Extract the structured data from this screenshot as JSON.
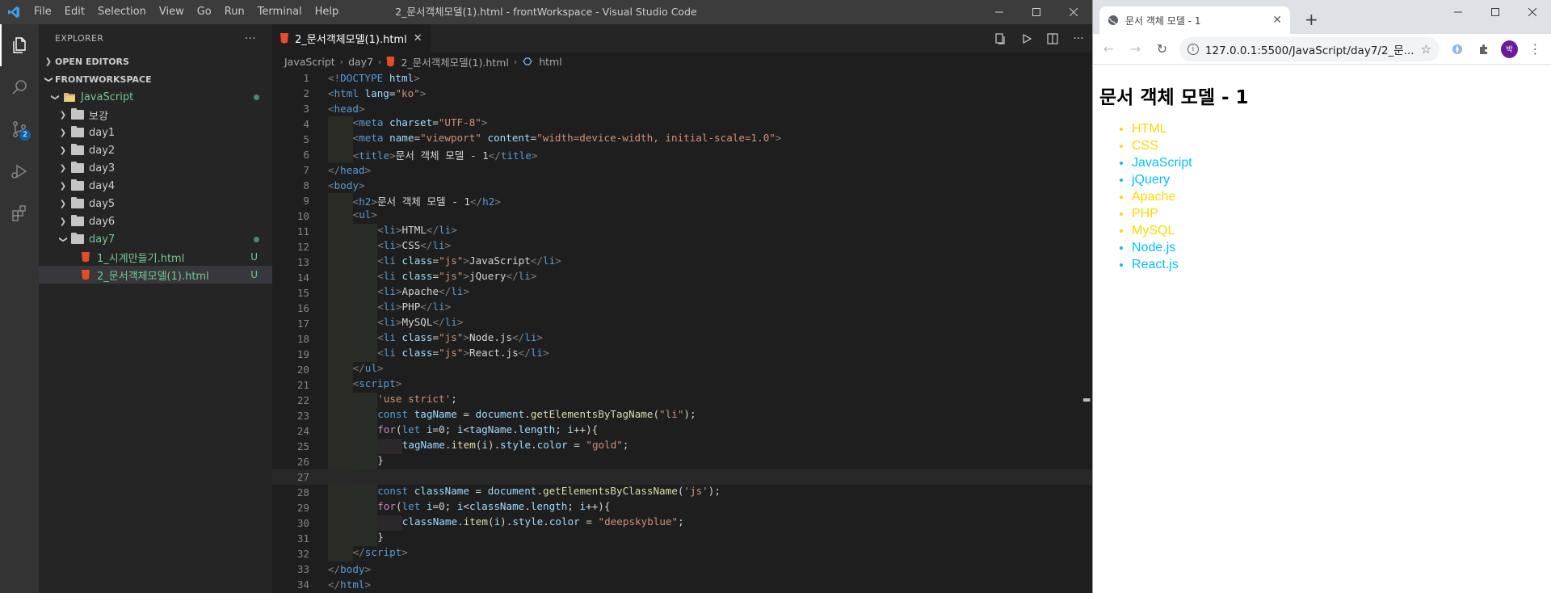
{
  "vscode": {
    "window_title": "2_문서객체모델(1).html - frontWorkspace - Visual Studio Code",
    "menu": [
      "File",
      "Edit",
      "Selection",
      "View",
      "Go",
      "Run",
      "Terminal",
      "Help"
    ],
    "activity_badge": "2",
    "explorer": {
      "title": "EXPLORER",
      "more": "···",
      "open_editors": "OPEN EDITORS",
      "workspace": "FRONTWORKSPACE",
      "tree": [
        {
          "label": "JavaScript",
          "type": "folder-open",
          "depth": 0,
          "color": "#73c991"
        },
        {
          "label": "보강",
          "type": "folder",
          "depth": 1
        },
        {
          "label": "day1",
          "type": "folder",
          "depth": 1
        },
        {
          "label": "day2",
          "type": "folder",
          "depth": 1
        },
        {
          "label": "day3",
          "type": "folder",
          "depth": 1
        },
        {
          "label": "day4",
          "type": "folder",
          "depth": 1
        },
        {
          "label": "day5",
          "type": "folder",
          "depth": 1
        },
        {
          "label": "day6",
          "type": "folder",
          "depth": 1
        },
        {
          "label": "day7",
          "type": "folder-open",
          "depth": 1,
          "color": "#73c991"
        },
        {
          "label": "1_시계만들기.html",
          "type": "html",
          "depth": 2,
          "status": "U",
          "color": "#73c991"
        },
        {
          "label": "2_문서객체모델(1).html",
          "type": "html",
          "depth": 2,
          "status": "U",
          "color": "#73c991",
          "selected": true
        }
      ]
    },
    "tab": {
      "label": "2_문서객체모델(1).html",
      "close": "✕"
    },
    "breadcrumb": [
      "JavaScript",
      "day7",
      "2_문서객체모델(1).html",
      "html"
    ],
    "code_lines": [
      {
        "n": "1",
        "indent": 0,
        "html": "<span class='t-br'>&lt;!</span><span class='t-tag'>DOCTYPE</span> <span class='t-attr'>html</span><span class='t-br'>&gt;</span>"
      },
      {
        "n": "2",
        "indent": 0,
        "html": "<span class='t-br'>&lt;</span><span class='t-tag'>html</span> <span class='t-attr'>lang</span><span class='t-text'>=</span><span class='t-str'>\"ko\"</span><span class='t-br'>&gt;</span>"
      },
      {
        "n": "3",
        "indent": 0,
        "html": "<span class='t-br'>&lt;</span><span class='t-tag'>head</span><span class='t-br'>&gt;</span>"
      },
      {
        "n": "4",
        "indent": 1,
        "html": "<span class='t-br'>&lt;</span><span class='t-tag'>meta</span> <span class='t-attr'>charset</span><span class='t-text'>=</span><span class='t-str'>\"UTF-8\"</span><span class='t-br'>&gt;</span>"
      },
      {
        "n": "5",
        "indent": 1,
        "html": "<span class='t-br'>&lt;</span><span class='t-tag'>meta</span> <span class='t-attr'>name</span><span class='t-text'>=</span><span class='t-str'>\"viewport\"</span> <span class='t-attr'>content</span><span class='t-text'>=</span><span class='t-str'>\"width=device-width, initial-scale=1.0\"</span><span class='t-br'>&gt;</span>"
      },
      {
        "n": "6",
        "indent": 1,
        "html": "<span class='t-br'>&lt;</span><span class='t-tag'>title</span><span class='t-br'>&gt;</span><span class='t-text'>문서 객체 모델 - 1</span><span class='t-br'>&lt;/</span><span class='t-tag'>title</span><span class='t-br'>&gt;</span>"
      },
      {
        "n": "7",
        "indent": 0,
        "html": "<span class='t-br'>&lt;/</span><span class='t-tag'>head</span><span class='t-br'>&gt;</span>"
      },
      {
        "n": "8",
        "indent": 0,
        "html": "<span class='t-br'>&lt;</span><span class='t-tag'>body</span><span class='t-br'>&gt;</span>"
      },
      {
        "n": "9",
        "indent": 1,
        "html": "<span class='t-br'>&lt;</span><span class='t-tag'>h2</span><span class='t-br'>&gt;</span><span class='t-text'>문서 객체 모델 - 1</span><span class='t-br'>&lt;/</span><span class='t-tag'>h2</span><span class='t-br'>&gt;</span>"
      },
      {
        "n": "10",
        "indent": 1,
        "html": "<span class='t-br'>&lt;</span><span class='t-tag'>ul</span><span class='t-br'>&gt;</span>"
      },
      {
        "n": "11",
        "indent": 2,
        "html": "<span class='t-br'>&lt;</span><span class='t-tag'>li</span><span class='t-br'>&gt;</span><span class='t-text'>HTML</span><span class='t-br'>&lt;/</span><span class='t-tag'>li</span><span class='t-br'>&gt;</span>"
      },
      {
        "n": "12",
        "indent": 2,
        "html": "<span class='t-br'>&lt;</span><span class='t-tag'>li</span><span class='t-br'>&gt;</span><span class='t-text'>CSS</span><span class='t-br'>&lt;/</span><span class='t-tag'>li</span><span class='t-br'>&gt;</span>"
      },
      {
        "n": "13",
        "indent": 2,
        "html": "<span class='t-br'>&lt;</span><span class='t-tag'>li</span> <span class='t-attr'>class</span><span class='t-text'>=</span><span class='t-str'>\"js\"</span><span class='t-br'>&gt;</span><span class='t-text'>JavaScript</span><span class='t-br'>&lt;/</span><span class='t-tag'>li</span><span class='t-br'>&gt;</span>"
      },
      {
        "n": "14",
        "indent": 2,
        "html": "<span class='t-br'>&lt;</span><span class='t-tag'>li</span> <span class='t-attr'>class</span><span class='t-text'>=</span><span class='t-str'>\"js\"</span><span class='t-br'>&gt;</span><span class='t-text'>jQuery</span><span class='t-br'>&lt;/</span><span class='t-tag'>li</span><span class='t-br'>&gt;</span>"
      },
      {
        "n": "15",
        "indent": 2,
        "html": "<span class='t-br'>&lt;</span><span class='t-tag'>li</span><span class='t-br'>&gt;</span><span class='t-text'>Apache</span><span class='t-br'>&lt;/</span><span class='t-tag'>li</span><span class='t-br'>&gt;</span>"
      },
      {
        "n": "16",
        "indent": 2,
        "html": "<span class='t-br'>&lt;</span><span class='t-tag'>li</span><span class='t-br'>&gt;</span><span class='t-text'>PHP</span><span class='t-br'>&lt;/</span><span class='t-tag'>li</span><span class='t-br'>&gt;</span>"
      },
      {
        "n": "17",
        "indent": 2,
        "html": "<span class='t-br'>&lt;</span><span class='t-tag'>li</span><span class='t-br'>&gt;</span><span class='t-text'>MySQL</span><span class='t-br'>&lt;/</span><span class='t-tag'>li</span><span class='t-br'>&gt;</span>"
      },
      {
        "n": "18",
        "indent": 2,
        "html": "<span class='t-br'>&lt;</span><span class='t-tag'>li</span> <span class='t-attr'>class</span><span class='t-text'>=</span><span class='t-str'>\"js\"</span><span class='t-br'>&gt;</span><span class='t-text'>Node.js</span><span class='t-br'>&lt;/</span><span class='t-tag'>li</span><span class='t-br'>&gt;</span>"
      },
      {
        "n": "19",
        "indent": 2,
        "html": "<span class='t-br'>&lt;</span><span class='t-tag'>li</span> <span class='t-attr'>class</span><span class='t-text'>=</span><span class='t-str'>\"js\"</span><span class='t-br'>&gt;</span><span class='t-text'>React.js</span><span class='t-br'>&lt;/</span><span class='t-tag'>li</span><span class='t-br'>&gt;</span>"
      },
      {
        "n": "20",
        "indent": 1,
        "html": "<span class='t-br'>&lt;/</span><span class='t-tag'>ul</span><span class='t-br'>&gt;</span>"
      },
      {
        "n": "21",
        "indent": 1,
        "html": "<span class='t-br'>&lt;</span><span class='t-tag'>script</span><span class='t-br'>&gt;</span>"
      },
      {
        "n": "22",
        "indent": 2,
        "html": "<span class='t-str'>'use strict'</span><span class='t-text'>;</span>"
      },
      {
        "n": "23",
        "indent": 2,
        "html": "<span class='t-kw'>const</span> <span class='t-var'>tagName</span> <span class='t-text'>=</span> <span class='t-var'>document</span><span class='t-text'>.</span><span class='t-fn'>getElementsByTagName</span><span class='t-text'>(</span><span class='t-str'>\"li\"</span><span class='t-text'>);</span>"
      },
      {
        "n": "24",
        "indent": 2,
        "html": "<span class='t-ctl'>for</span><span class='t-text'>(</span><span class='t-kw'>let</span> <span class='t-var'>i</span><span class='t-text'>=0; </span><span class='t-var'>i</span><span class='t-text'>&lt;</span><span class='t-var'>tagName</span><span class='t-text'>.</span><span class='t-var'>length</span><span class='t-text'>; </span><span class='t-var'>i</span><span class='t-text'>++){</span>"
      },
      {
        "n": "25",
        "indent": 3,
        "html": "<span class='t-var'>tagName</span><span class='t-text'>.</span><span class='t-fn'>item</span><span class='t-text'>(</span><span class='t-var'>i</span><span class='t-text'>).</span><span class='t-var'>style</span><span class='t-text'>.</span><span class='t-var'>color</span> <span class='t-text'>=</span> <span class='t-str'>\"gold\"</span><span class='t-text'>;</span>"
      },
      {
        "n": "26",
        "indent": 2,
        "html": "<span class='t-text'>}</span>"
      },
      {
        "n": "27",
        "indent": 0,
        "html": "",
        "current": true
      },
      {
        "n": "28",
        "indent": 2,
        "html": "<span class='t-kw'>const</span> <span class='t-var'>className</span> <span class='t-text'>=</span> <span class='t-var'>document</span><span class='t-text'>.</span><span class='t-fn'>getElementsByClassName</span><span class='t-text'>(</span><span class='t-str'>'js'</span><span class='t-text'>);</span>"
      },
      {
        "n": "29",
        "indent": 2,
        "html": "<span class='t-ctl'>for</span><span class='t-text'>(</span><span class='t-kw'>let</span> <span class='t-var'>i</span><span class='t-text'>=0; </span><span class='t-var'>i</span><span class='t-text'>&lt;</span><span class='t-var'>className</span><span class='t-text'>.</span><span class='t-var'>length</span><span class='t-text'>; </span><span class='t-var'>i</span><span class='t-text'>++){</span>"
      },
      {
        "n": "30",
        "indent": 3,
        "html": "<span class='t-var'>className</span><span class='t-text'>.</span><span class='t-fn'>item</span><span class='t-text'>(</span><span class='t-var'>i</span><span class='t-text'>).</span><span class='t-var'>style</span><span class='t-text'>.</span><span class='t-var'>color</span> <span class='t-text'>=</span> <span class='t-str'>\"deepskyblue\"</span><span class='t-text'>;</span>"
      },
      {
        "n": "31",
        "indent": 2,
        "html": "<span class='t-text'>}</span>"
      },
      {
        "n": "32",
        "indent": 1,
        "html": "<span class='t-br'>&lt;/</span><span class='t-tag'>script</span><span class='t-br'>&gt;</span>"
      },
      {
        "n": "33",
        "indent": 0,
        "html": "<span class='t-br'>&lt;/</span><span class='t-tag'>body</span><span class='t-br'>&gt;</span>"
      },
      {
        "n": "34",
        "indent": 0,
        "html": "<span class='t-br'>&lt;/</span><span class='t-tag'>html</span><span class='t-br'>&gt;</span>"
      }
    ]
  },
  "chrome": {
    "tab_title": "문서 객체 모델 - 1",
    "url": "127.0.0.1:5500/JavaScript/day7/2_문...",
    "avatar": "박",
    "page": {
      "heading": "문서 객체 모델 - 1",
      "items": [
        {
          "text": "HTML",
          "color": "gold"
        },
        {
          "text": "CSS",
          "color": "gold"
        },
        {
          "text": "JavaScript",
          "color": "deepskyblue"
        },
        {
          "text": "jQuery",
          "color": "deepskyblue"
        },
        {
          "text": "Apache",
          "color": "gold"
        },
        {
          "text": "PHP",
          "color": "gold"
        },
        {
          "text": "MySQL",
          "color": "gold"
        },
        {
          "text": "Node.js",
          "color": "deepskyblue"
        },
        {
          "text": "React.js",
          "color": "deepskyblue"
        }
      ]
    }
  }
}
